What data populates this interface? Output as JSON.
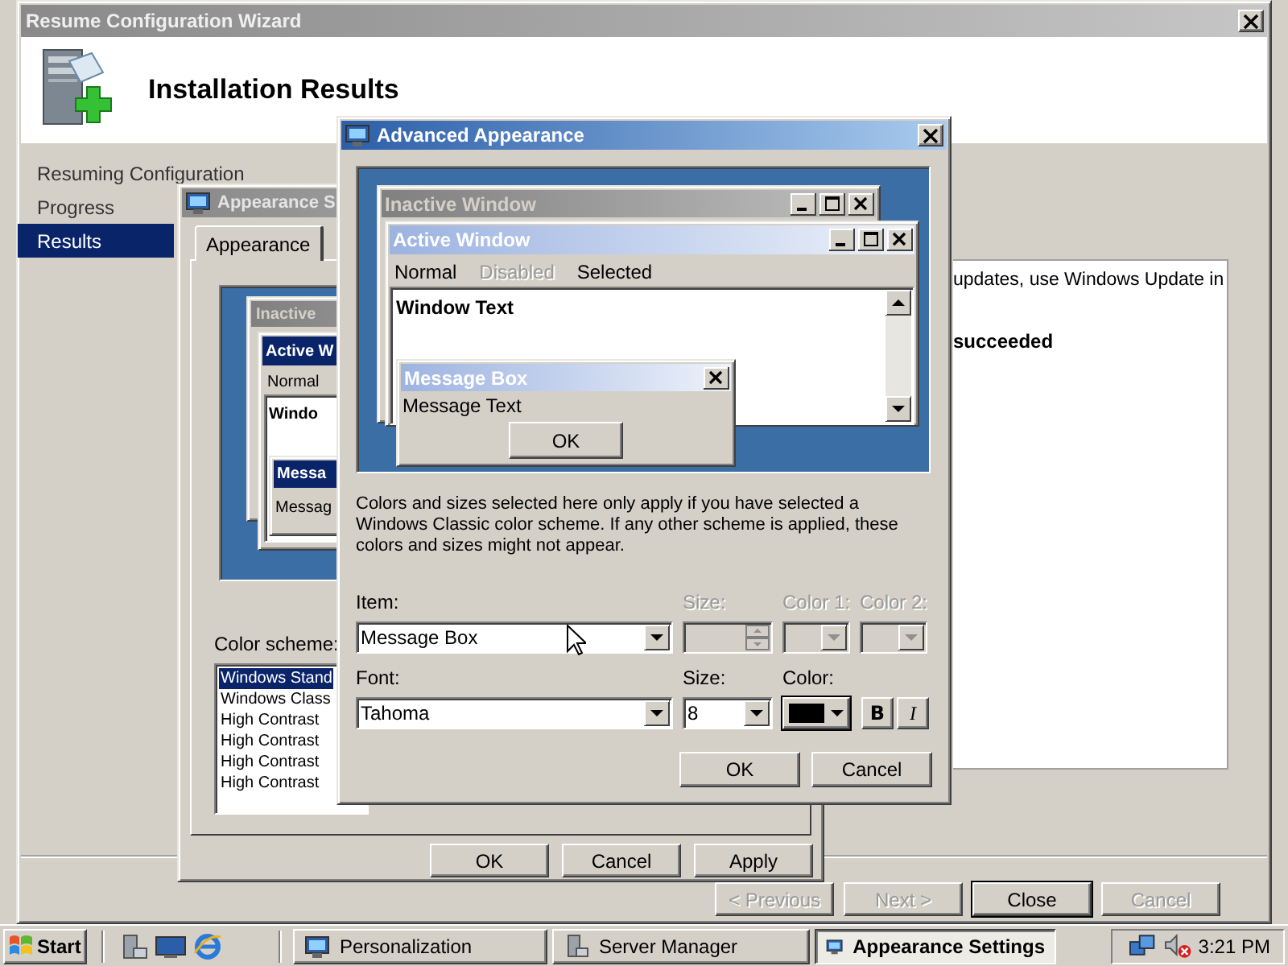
{
  "wizard": {
    "title": "Resume Configuration Wizard",
    "heading": "Installation Results",
    "steps": [
      {
        "label": "Resuming Configuration",
        "selected": false
      },
      {
        "label": "Progress",
        "selected": false
      },
      {
        "label": "Results",
        "selected": true
      }
    ],
    "results": [
      {
        "kind": "note",
        "text": "updates, use Windows Update in"
      },
      {
        "kind": "status",
        "text": "succeeded"
      }
    ],
    "buttons": [
      {
        "label": "< Previous",
        "disabled": true,
        "default": false
      },
      {
        "label": "Next >",
        "disabled": true,
        "default": false
      },
      {
        "label": "Close",
        "disabled": false,
        "default": true
      },
      {
        "label": "Cancel",
        "disabled": true,
        "default": false
      }
    ]
  },
  "appearance_settings": {
    "title": "Appearance S",
    "tabs": [
      {
        "label": "Appearance",
        "selected": true
      }
    ],
    "preview": {
      "inactive_title": "Inactive",
      "active_title": "Active W",
      "menu_item": "Normal",
      "window_text": "Windo",
      "message_title": "Messa",
      "message_text": "Messag"
    },
    "color_scheme": {
      "label": "Color scheme:",
      "items": [
        {
          "label": "Windows Stand",
          "selected": true
        },
        {
          "label": "Windows Class",
          "selected": false
        },
        {
          "label": "High Contrast",
          "selected": false
        },
        {
          "label": "High Contrast",
          "selected": false
        },
        {
          "label": "High Contrast",
          "selected": false
        },
        {
          "label": "High Contrast",
          "selected": false
        }
      ]
    },
    "buttons": [
      "OK",
      "Cancel",
      "Apply"
    ]
  },
  "advanced_appearance": {
    "title": "Advanced Appearance",
    "preview": {
      "inactive_title": "Inactive Window",
      "active_title": "Active Window",
      "menu": [
        {
          "label": "Normal",
          "disabled": false
        },
        {
          "label": "Disabled",
          "disabled": true
        },
        {
          "label": "Selected",
          "disabled": false
        }
      ],
      "window_text": "Window Text",
      "message_title": "Message Box",
      "message_text": "Message Text",
      "message_button": "OK"
    },
    "note": "Colors and sizes selected here only apply if you have selected a Windows Classic color scheme. If any other scheme is applied, these colors and sizes might not appear.",
    "fields": [
      [
        {
          "kind": "combo",
          "label": "Item:",
          "value": "Message Box",
          "disabled": false
        },
        {
          "kind": "spin",
          "label": "Size:",
          "disabled": true
        },
        {
          "kind": "combo",
          "label": "Color 1:",
          "disabled": true
        },
        {
          "kind": "combo",
          "label": "Color 2:",
          "disabled": true
        }
      ],
      [
        {
          "kind": "combo",
          "label": "Font:",
          "value": "Tahoma",
          "disabled": false
        },
        {
          "kind": "combo",
          "label": "Size:",
          "value": "8",
          "disabled": false
        },
        {
          "kind": "color",
          "label": "Color:",
          "color": "#000000",
          "disabled": false
        },
        {
          "kind": "styles",
          "buttons": [
            {
              "kind": "bold",
              "label": "B"
            },
            {
              "kind": "italic",
              "label": "I"
            }
          ]
        }
      ]
    ],
    "buttons": [
      "OK",
      "Cancel"
    ]
  },
  "taskbar": {
    "start": "Start",
    "tasks": [
      {
        "label": "Personalization",
        "selected": false
      },
      {
        "label": "Server Manager",
        "selected": false
      },
      {
        "label": "Appearance Settings",
        "selected": true
      }
    ],
    "clock": "3:21 PM"
  }
}
